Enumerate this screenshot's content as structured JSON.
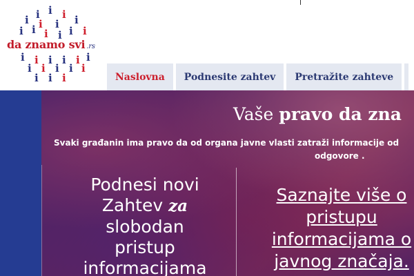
{
  "logo": {
    "text": "da znamo svi",
    "suffix": ".rs",
    "dot_glyph": "i",
    "colors": {
      "brand_red": "#c21c2a",
      "brand_blue": "#27327f"
    }
  },
  "nav": {
    "tabs": [
      {
        "label": "Naslovna",
        "active": true
      },
      {
        "label": "Podnesite zahtev",
        "active": false
      },
      {
        "label": "Pretražite zahteve",
        "active": false
      }
    ]
  },
  "hero": {
    "title_plain": "Vaše",
    "title_bold": "pravo da zna",
    "subtitle_line1": "Svaki građanin ima pravo da od organa javne vlasti zatraži informacije od",
    "subtitle_link": "odgovore",
    "subtitle_end": ".",
    "cta_left": {
      "line1": "Podnesi novi",
      "line2_a": "Zahtev",
      "line2_b": "za",
      "line3": "slobodan",
      "line4": "pristup",
      "line5": "informacijama"
    },
    "cta_right": {
      "line1": "Saznajte više o",
      "line2": "pristupu",
      "line3": "informacijama o",
      "line4": "javnog značaja."
    }
  }
}
